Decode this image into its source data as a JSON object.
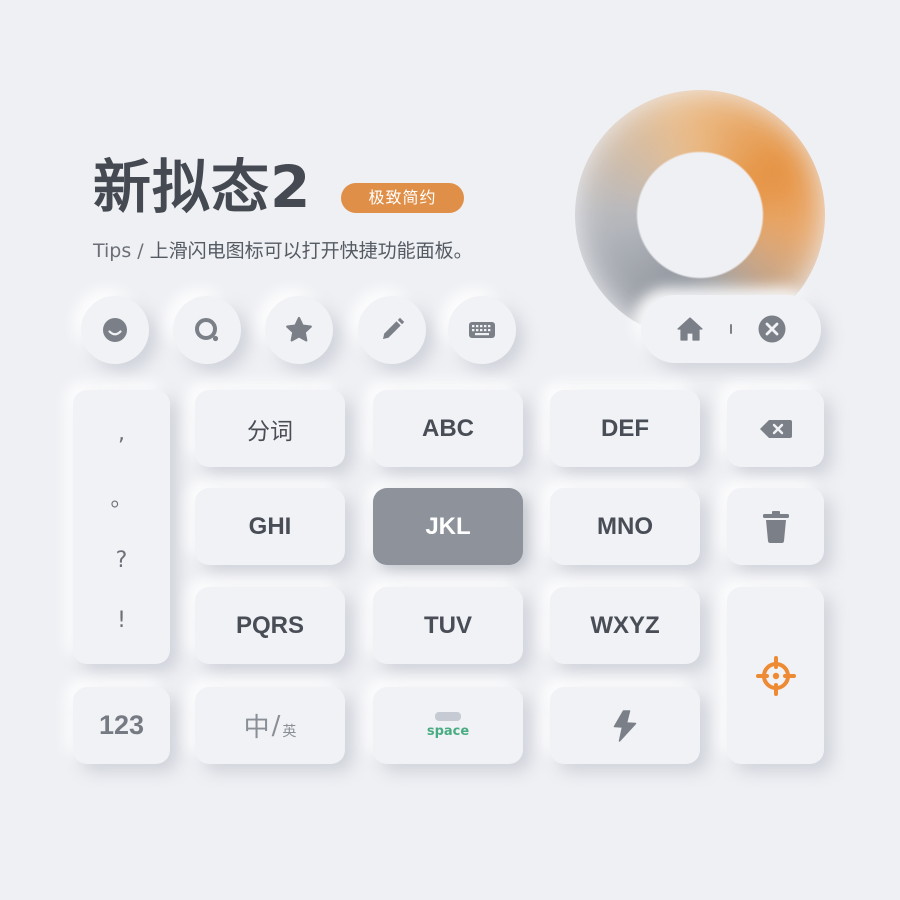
{
  "header": {
    "title": "新拟态2",
    "badge": "极致简约",
    "tips_label": "Tips",
    "tips_sep": "/",
    "tips_text": "上滑闪电图标可以打开快捷功能面板。"
  },
  "toolbar": {
    "icons": [
      "emoji-icon",
      "search-icon",
      "star-icon",
      "pencil-icon",
      "keyboard-icon"
    ]
  },
  "nav_pill": {
    "icons": [
      "home-icon",
      "close-icon"
    ]
  },
  "keyboard": {
    "punctuation": [
      ",",
      "。",
      "?",
      "!"
    ],
    "rows": [
      [
        "分词",
        "ABC",
        "DEF"
      ],
      [
        "GHI",
        "JKL",
        "MNO"
      ],
      [
        "PQRS",
        "TUV",
        "WXYZ"
      ]
    ],
    "active_key": "JKL",
    "num_label": "123",
    "lang": {
      "primary": "中",
      "slash": "/",
      "secondary": "英"
    },
    "space_label": "space",
    "right_column_icons": [
      "backspace-icon",
      "trash-icon",
      "crosshair-icon"
    ],
    "bottom_icons": [
      "lightning-icon"
    ]
  },
  "colors": {
    "background": "#eff0f4",
    "accent_orange": "#df8f47",
    "key_active": "#8d929b",
    "text_dark": "#484d56",
    "space_green": "#4aac82",
    "crosshair_orange": "#ee8a33"
  }
}
